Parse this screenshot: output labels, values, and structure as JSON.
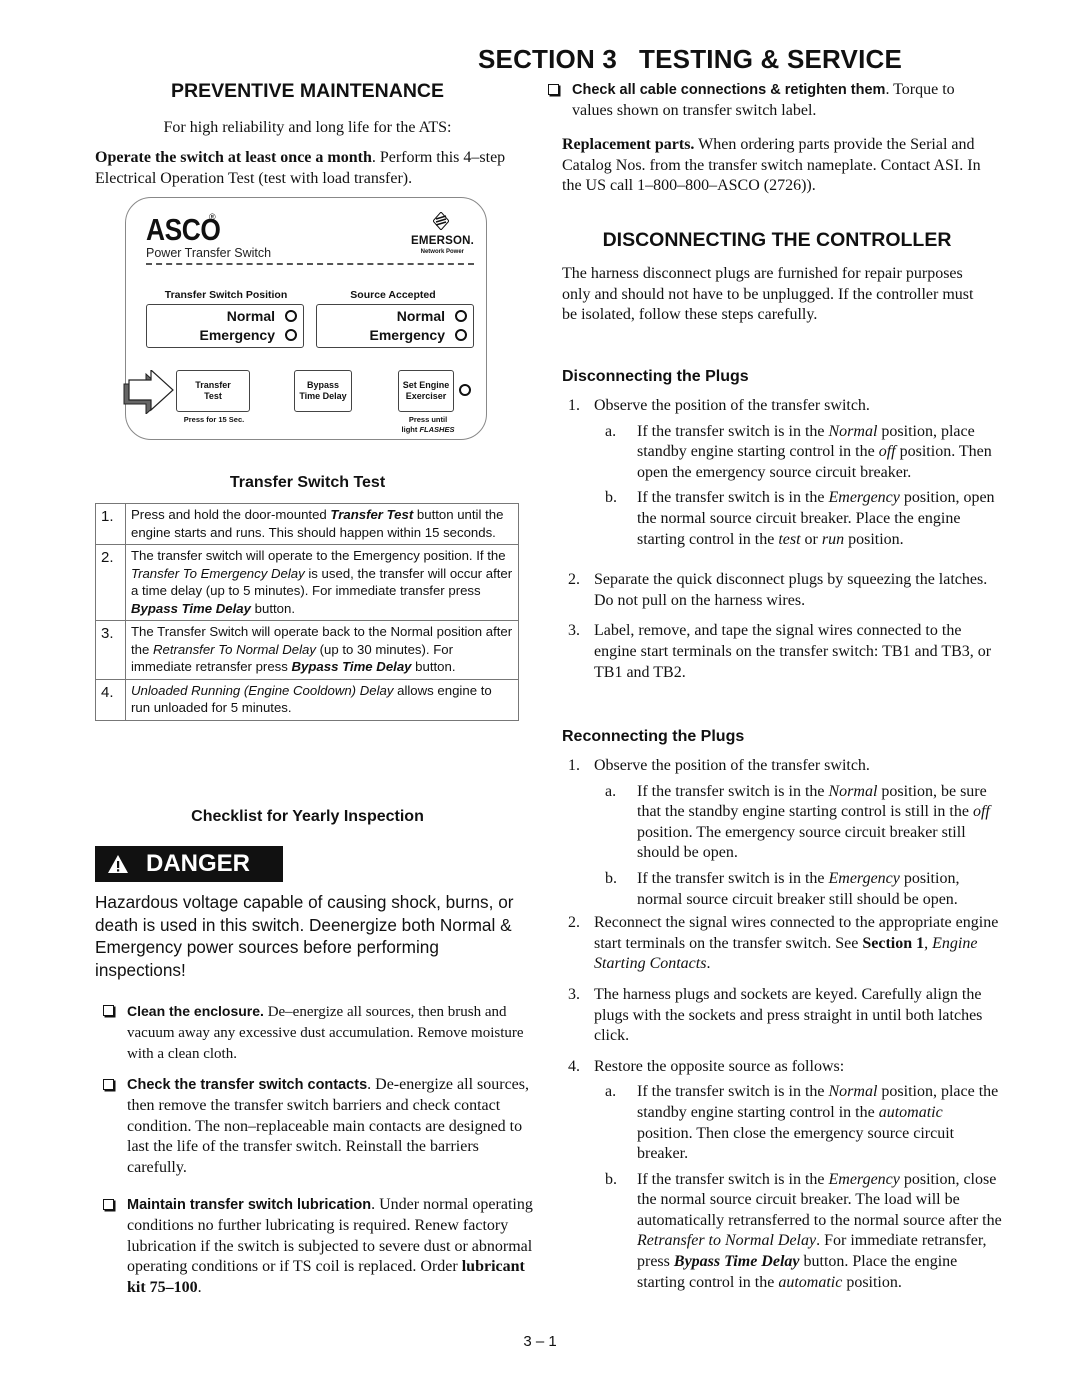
{
  "header": {
    "section_number": "SECTION 3",
    "section_title": "TESTING & SERVICE"
  },
  "preventive_maintenance": {
    "title": "PREVENTIVE MAINTENANCE",
    "intro": "For high reliability and long life for the ATS:",
    "operate": [
      {
        "t": "Operate the switch at least once a month",
        "s": "b"
      },
      {
        "t": ".  Perform this 4–step Electrical Operation Test (test with load transfer)."
      }
    ]
  },
  "panel": {
    "brand": "ASCO",
    "registered_mark": "®",
    "subtitle": "Power Transfer Switch",
    "partner_logo": "EMERSON.",
    "partner_sub": "Network Power",
    "partner_icon": "emerson-logo-icon",
    "groups": [
      {
        "label": "Transfer Switch Position",
        "rows": [
          "Normal",
          "Emergency"
        ]
      },
      {
        "label": "Source Accepted",
        "rows": [
          "Normal",
          "Emergency"
        ]
      }
    ],
    "buttons": [
      {
        "line1": "Transfer",
        "line2": "Test",
        "note": "Press for 15 Sec."
      },
      {
        "line1": "Bypass",
        "line2": "Time Delay",
        "note": ""
      },
      {
        "line1": "Set Engine",
        "line2": "Exerciser",
        "note_line1": "Press until",
        "note_line2_plain": "light ",
        "note_line2_italic": "FLASHES"
      }
    ],
    "pointer_icon": "arrow-right-icon"
  },
  "transfer_switch_test": {
    "title": "Transfer Switch Test",
    "steps": [
      {
        "num": "1.",
        "text": [
          {
            "t": "Press and hold the door-mounted "
          },
          {
            "t": "Transfer Test",
            "s": "bi"
          },
          {
            "t": " button until the engine starts and runs. This should happen within 15 seconds."
          }
        ]
      },
      {
        "num": "2.",
        "text": [
          {
            "t": "The transfer switch will operate to the Emergency position.  If the "
          },
          {
            "t": "Transfer To Emergency Delay",
            "s": "i"
          },
          {
            "t": " is used, the transfer will occur after a time delay (up to 5 minutes). For immediate transfer press "
          },
          {
            "t": "Bypass Time Delay",
            "s": "bi"
          },
          {
            "t": " button."
          }
        ]
      },
      {
        "num": "3.",
        "text": [
          {
            "t": "The Transfer Switch will operate back to the Normal position after the "
          },
          {
            "t": "Retransfer To Normal Delay",
            "s": "i"
          },
          {
            "t": " (up to 30 minutes).  For immediate retransfer press "
          },
          {
            "t": "Bypass Time Delay",
            "s": "bi"
          },
          {
            "t": " button."
          }
        ]
      },
      {
        "num": "4.",
        "text": [
          {
            "t": "Unloaded Running (Engine Cooldown) Delay",
            "s": "i"
          },
          {
            "t": " allows engine to run unloaded for 5 minutes."
          }
        ]
      }
    ]
  },
  "yearly_inspection": {
    "title": "Checklist for Yearly Inspection",
    "danger": {
      "icon": "warning-triangle-icon",
      "label": "DANGER",
      "text": "Hazardous voltage capable of causing shock, burns, or death is used in this switch. Deenergize both Normal & Emergency power sources before performing inspections!"
    },
    "items": [
      {
        "lead": "Clean the enclosure.",
        "text": [
          {
            "t": "  De–energize all sources, then brush and vacuum away any excessive dust accumulation. Remove moisture with a clean cloth."
          }
        ]
      },
      {
        "lead": "Check the transfer switch contacts",
        "text": [
          {
            "t": ".  De-energize all sources, then remove the transfer switch barriers and check contact condition.  The non–replaceable main contacts are designed to last the life of the transfer switch.  Reinstall the barriers carefully."
          }
        ]
      },
      {
        "lead": "Maintain transfer switch lubrication",
        "text": [
          {
            "t": ". Under normal operating conditions no further lubricating is required.  Renew factory lubrication if the switch is subjected to severe dust or abnormal operating conditions or if TS coil is replaced. Order "
          },
          {
            "t": "lubricant kit 75–100",
            "s": "b"
          },
          {
            "t": "."
          }
        ]
      },
      {
        "lead": "Check all cable connections & retighten them",
        "text": [
          {
            "t": ". Torque to values shown on transfer switch label."
          }
        ]
      }
    ]
  },
  "replacement_parts": [
    {
      "t": "Replacement parts.",
      "s": "b"
    },
    {
      "t": " When ordering parts provide the Serial and Catalog Nos. from the transfer switch nameplate.  Contact ASI. In the US call 1–800–800–ASCO (2726))."
    }
  ],
  "disconnecting_controller": {
    "title": "DISCONNECTING THE CONTROLLER",
    "intro": "The harness disconnect plugs are furnished for repair purposes only and should not have to be unplugged. If the controller must be isolated, follow these steps carefully.",
    "disconnecting_plugs": {
      "title": "Disconnecting the Plugs",
      "steps": [
        {
          "num": "1.",
          "text": [
            {
              "t": "Observe the position of the transfer switch."
            }
          ],
          "subs": [
            {
              "num": "a.",
              "text": [
                {
                  "t": "If the transfer switch is in the "
                },
                {
                  "t": "Normal",
                  "s": "i"
                },
                {
                  "t": " position, place standby engine starting control in the "
                },
                {
                  "t": "off",
                  "s": "i"
                },
                {
                  "t": " position.  Then open the emergency source circuit breaker."
                }
              ]
            },
            {
              "num": "b.",
              "text": [
                {
                  "t": "If the transfer switch is in the "
                },
                {
                  "t": "Emergency",
                  "s": "i"
                },
                {
                  "t": " position, open the normal source circuit breaker.  Place the engine starting control in the "
                },
                {
                  "t": "test",
                  "s": "i"
                },
                {
                  "t": " or "
                },
                {
                  "t": "run",
                  "s": "i"
                },
                {
                  "t": " position."
                }
              ]
            }
          ]
        },
        {
          "num": "2.",
          "text": [
            {
              "t": "Separate the quick disconnect plugs by squeezing the latches.  Do not pull on the harness wires."
            }
          ]
        },
        {
          "num": "3.",
          "text": [
            {
              "t": "Label, remove, and tape the signal wires connected to the engine start terminals on the transfer switch: TB1 and TB3, or TB1 and TB2."
            }
          ]
        }
      ]
    },
    "reconnecting_plugs": {
      "title": "Reconnecting the Plugs",
      "steps": [
        {
          "num": "1.",
          "text": [
            {
              "t": "Observe the position of the transfer switch."
            }
          ],
          "subs": [
            {
              "num": "a.",
              "text": [
                {
                  "t": "If the transfer switch is in the "
                },
                {
                  "t": "Normal",
                  "s": "i"
                },
                {
                  "t": " position, be sure that the standby engine starting control is still in the "
                },
                {
                  "t": "off",
                  "s": "i"
                },
                {
                  "t": " position.  The emergency source circuit breaker still should be open."
                }
              ]
            },
            {
              "num": "b.",
              "text": [
                {
                  "t": "If the transfer switch is in the "
                },
                {
                  "t": "Emergency",
                  "s": "i"
                },
                {
                  "t": " position, normal source circuit breaker still should be open."
                }
              ]
            }
          ]
        },
        {
          "num": "2.",
          "text": [
            {
              "t": "Reconnect the signal wires connected to the appropriate engine start terminals on the transfer switch.  See "
            },
            {
              "t": "Section 1",
              "s": "b"
            },
            {
              "t": ", "
            },
            {
              "t": "Engine Starting Contacts",
              "s": "i"
            },
            {
              "t": "."
            }
          ]
        },
        {
          "num": "3.",
          "text": [
            {
              "t": "The harness plugs and sockets are keyed. Carefully align the plugs with the sockets and press straight in until both latches click."
            }
          ]
        },
        {
          "num": "4.",
          "text": [
            {
              "t": "Restore the opposite source as follows:"
            }
          ],
          "subs": [
            {
              "num": "a.",
              "text": [
                {
                  "t": "If the transfer switch is in the "
                },
                {
                  "t": "Normal",
                  "s": "i"
                },
                {
                  "t": " position, place the standby engine starting control in the "
                },
                {
                  "t": "automatic",
                  "s": "i"
                },
                {
                  "t": " position.  Then close the emergency source circuit breaker."
                }
              ]
            },
            {
              "num": "b.",
              "text": [
                {
                  "t": "If the transfer switch is in the "
                },
                {
                  "t": "Emergency",
                  "s": "i"
                },
                {
                  "t": " position, close the normal source circuit breaker. The load will be automatically retransferred to the normal source after the "
                },
                {
                  "t": "Retransfer to Normal Delay",
                  "s": "i"
                },
                {
                  "t": ". For immediate retransfer, press "
                },
                {
                  "t": "Bypass Time Delay",
                  "s": "bi"
                },
                {
                  "t": " button.  Place the engine starting control in the "
                },
                {
                  "t": "automatic",
                  "s": "i"
                },
                {
                  "t": " position."
                }
              ]
            }
          ]
        }
      ]
    }
  },
  "footer": {
    "page_number": "3 – 1"
  }
}
